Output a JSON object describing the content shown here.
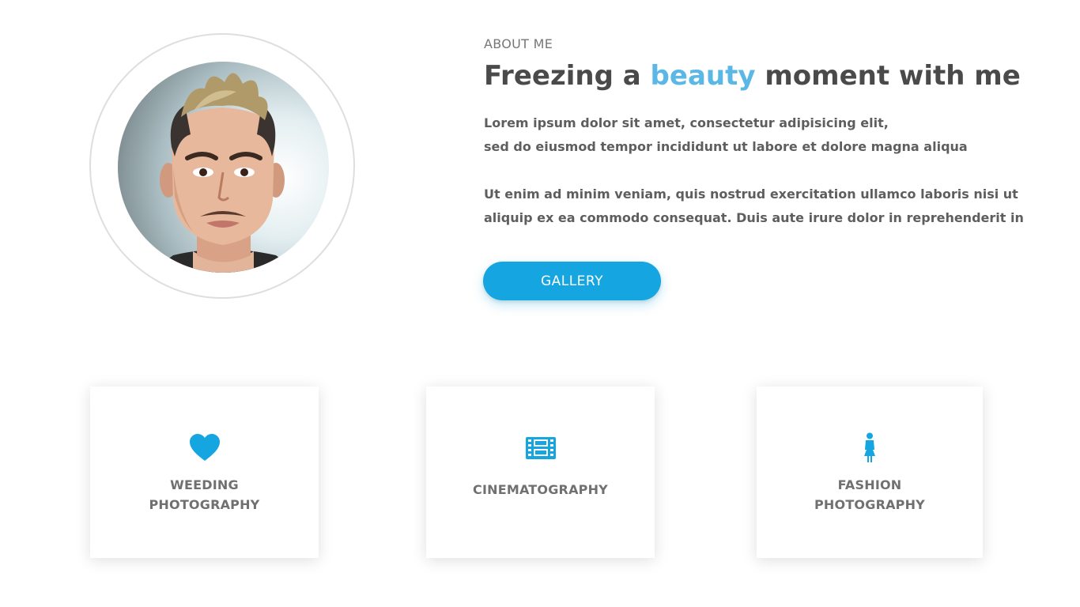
{
  "about": {
    "eyebrow": "ABOUT ME",
    "headline_before": "Freezing a ",
    "headline_accent": "beauty",
    "headline_after": " moment with me",
    "paragraph_1_lines": [
      "Lorem ipsum dolor sit amet, consectetur adipisicing elit,",
      "sed do eiusmod tempor incididunt ut labore et dolore magna aliqua"
    ],
    "paragraph_2_lines": [
      "Ut enim ad minim veniam, quis nostrud exercitation ullamco laboris nisi ut",
      "aliquip ex ea commodo consequat. Duis aute irure dolor in reprehenderit in"
    ],
    "gallery_button": "GALLERY"
  },
  "services": [
    {
      "icon": "heart-icon",
      "title_lines": [
        "WEEDING",
        "PHOTOGRAPHY"
      ]
    },
    {
      "icon": "film-icon",
      "title_lines": [
        "CINEMATOGRAPHY"
      ]
    },
    {
      "icon": "female-icon",
      "title_lines": [
        "FASHION",
        "PHOTOGRAPHY"
      ]
    }
  ],
  "colors": {
    "accent": "#15a5e0",
    "accent_light": "#5bb8e6",
    "heading": "#4a4a4a",
    "body_text": "#5e5e5e",
    "card_text": "#707070"
  }
}
